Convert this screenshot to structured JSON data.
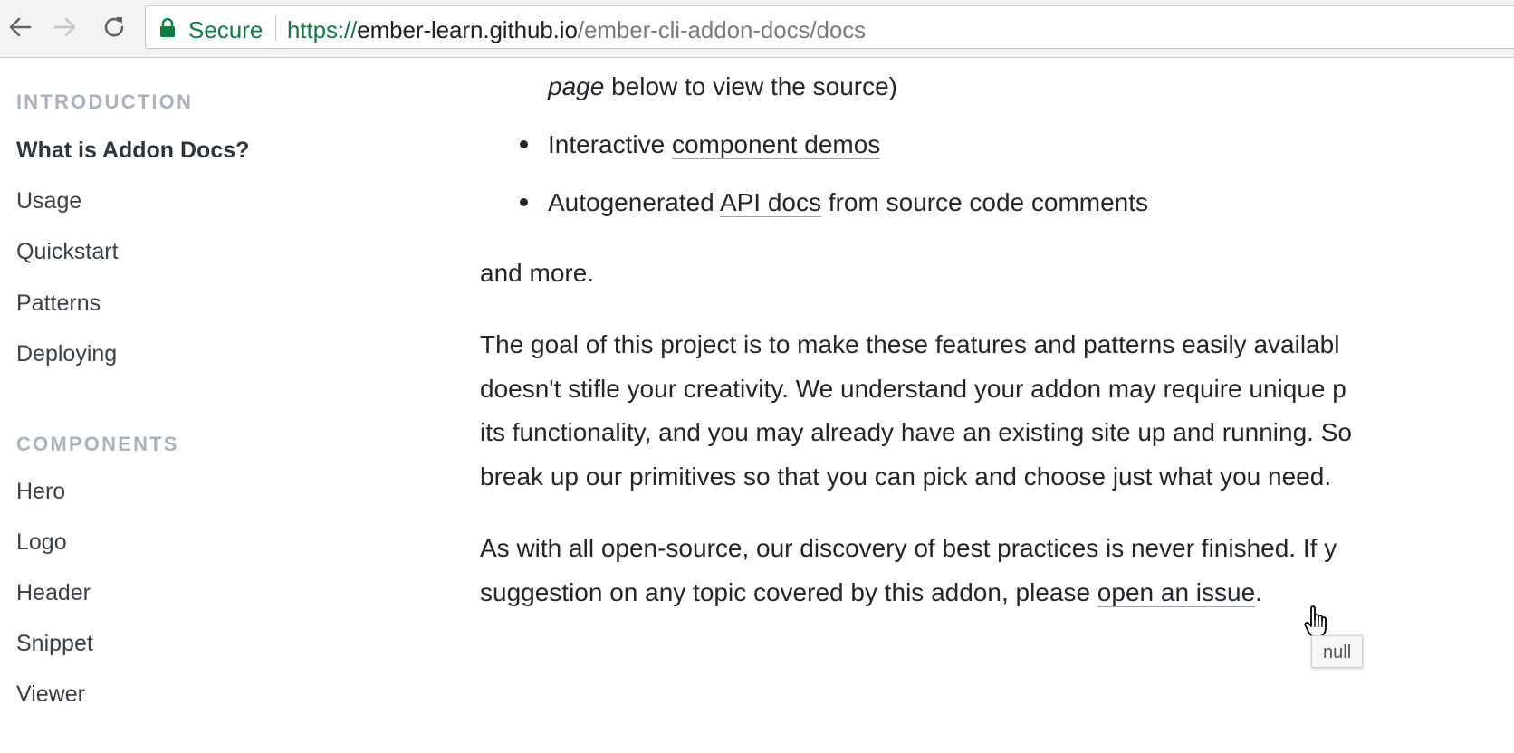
{
  "browser": {
    "secure_label": "Secure",
    "url_scheme": "https://",
    "url_host": "ember-learn.github.io",
    "url_path": "/ember-cli-addon-docs/docs"
  },
  "sidebar": {
    "sections": [
      {
        "title": "INTRODUCTION",
        "items": [
          {
            "label": "What is Addon Docs?",
            "active": true
          },
          {
            "label": "Usage"
          },
          {
            "label": "Quickstart"
          },
          {
            "label": "Patterns"
          },
          {
            "label": "Deploying"
          }
        ]
      },
      {
        "title": "COMPONENTS",
        "items": [
          {
            "label": "Hero"
          },
          {
            "label": "Logo"
          },
          {
            "label": "Header"
          },
          {
            "label": "Snippet"
          },
          {
            "label": "Viewer"
          }
        ]
      }
    ]
  },
  "content": {
    "partial_line_em": "page",
    "partial_line_rest": " below to view the source)",
    "bullets": [
      {
        "before": "Interactive ",
        "link": "component demos",
        "after": ""
      },
      {
        "before": "Autogenerated ",
        "link": "API docs",
        "after": " from source code comments"
      }
    ],
    "and_more": "and more.",
    "goal_lines": [
      "The goal of this project is to make these features and patterns easily availabl",
      "doesn't stifle your creativity. We understand your addon may require unique p",
      "its functionality, and you may already have an existing site up and running. So",
      "break up our primitives so that you can pick and choose just what you need."
    ],
    "closing_line1": "As with all open-source, our discovery of best practices is never finished. If y",
    "closing_line2_before": "suggestion on any topic covered by this addon, please ",
    "closing_link": "open an issue",
    "closing_line2_after": "."
  },
  "tooltip": {
    "text": "null"
  }
}
